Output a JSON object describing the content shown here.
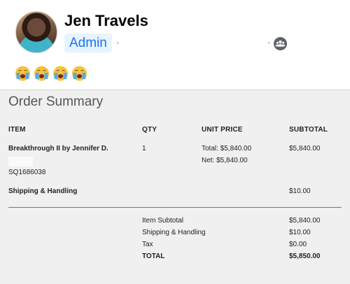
{
  "post": {
    "author": "Jen Travels",
    "role_badge": "Admin",
    "separator": "·",
    "icons": {
      "audience": "group-icon",
      "reaction": "crying-face-emoji"
    },
    "reactions": [
      "crying-face-emoji",
      "crying-face-emoji",
      "crying-face-emoji",
      "crying-face-emoji"
    ]
  },
  "order": {
    "title": "Order Summary",
    "columns": {
      "item": "ITEM",
      "qty": "QTY",
      "unit_price": "UNIT PRICE",
      "subtotal": "SUBTOTAL"
    },
    "item": {
      "name": "Breakthrough II by Jennifer D.",
      "sku": "SQ1686038",
      "qty": "1",
      "total_price": "Total: $5,840.00",
      "net_price": "Net: $5,840.00",
      "subtotal": "$5,840.00"
    },
    "shipping_line": {
      "label": "Shipping & Handling",
      "amount": "$10.00"
    },
    "totals": {
      "item_subtotal_label": "Item Subtotal",
      "item_subtotal": "$5,840.00",
      "shipping_label": "Shipping & Handling",
      "shipping": "$10.00",
      "tax_label": "Tax",
      "tax": "$0.00",
      "total_label": "TOTAL",
      "total": "$5,850.00"
    }
  },
  "colors": {
    "badge_bg": "#e7f3ff",
    "badge_text": "#1b74e4",
    "summary_bg": "#f0f0f0",
    "emoji_yellow": "#f5c33b",
    "tears": "#5aa9e6"
  }
}
